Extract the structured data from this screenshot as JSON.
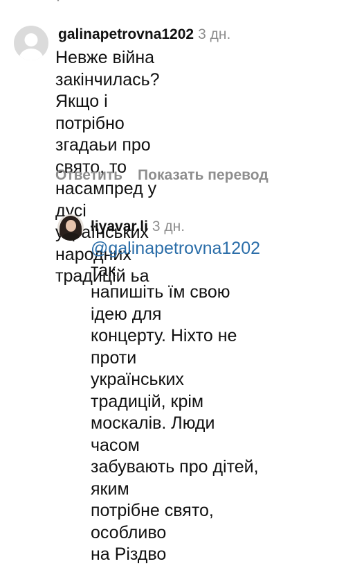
{
  "comments": [
    {
      "username": "galinapetrovna1202",
      "time": "3 дн.",
      "lines": [
        "Невже війна закінчилась?",
        "Якщо і потрібно згадаьи про",
        "свято, то насампред у дусі",
        "українських народних",
        "традицій ьа"
      ],
      "reply_label": "Ответить",
      "translate_label": "Показать перевод",
      "avatar": "default-avatar-icon"
    },
    {
      "username": "liyavar.li",
      "time": "3 дн.",
      "mention": "@galinapetrovna1202",
      "lines": [
        " так",
        "напишіть їм свою ідею для",
        "концерту. Ніхто не проти",
        "українських традицій, крім",
        "москалів. Люди часом",
        "забувають про дітей, яким",
        "потрібне свято, особливо",
        "на Різдво"
      ],
      "avatar": "profile-photo"
    }
  ],
  "colors": {
    "text": "#111111",
    "muted": "#8e8e8e",
    "mention": "#2b6ea9"
  }
}
